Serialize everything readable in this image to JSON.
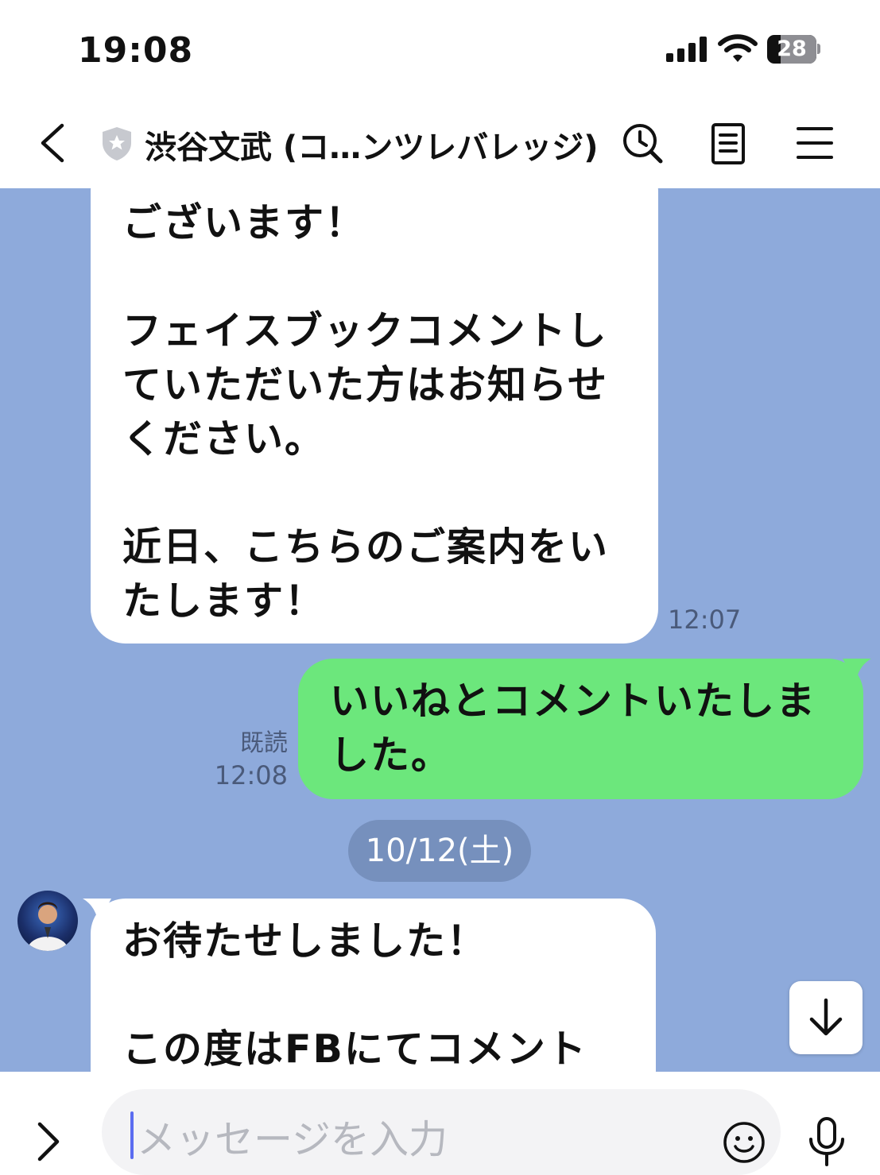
{
  "status_bar": {
    "time": "19:08",
    "battery": "28"
  },
  "header": {
    "title": "渋谷文武 (コ…ンツレバレッジ)"
  },
  "messages": {
    "in_1": {
      "text": "ございます！\n\nフェイスブックコメントし\nていただいた方はお知らせ\nください。\n\n近日、こちらのご案内をい\nたします！",
      "time": "12:07"
    },
    "out_1": {
      "text": "いいねとコメントいたしま\nした。",
      "read": "既読",
      "time": "12:08"
    },
    "date_separator": "10/12(土)",
    "in_2": {
      "text": "お待たせしました！\n\nこの度はFBにてコメント"
    }
  },
  "input": {
    "placeholder": "メッセージを入力"
  },
  "colors": {
    "chat_bg": "#8eaadb",
    "outgoing_bubble": "#6ce77c",
    "incoming_bubble": "#ffffff"
  }
}
